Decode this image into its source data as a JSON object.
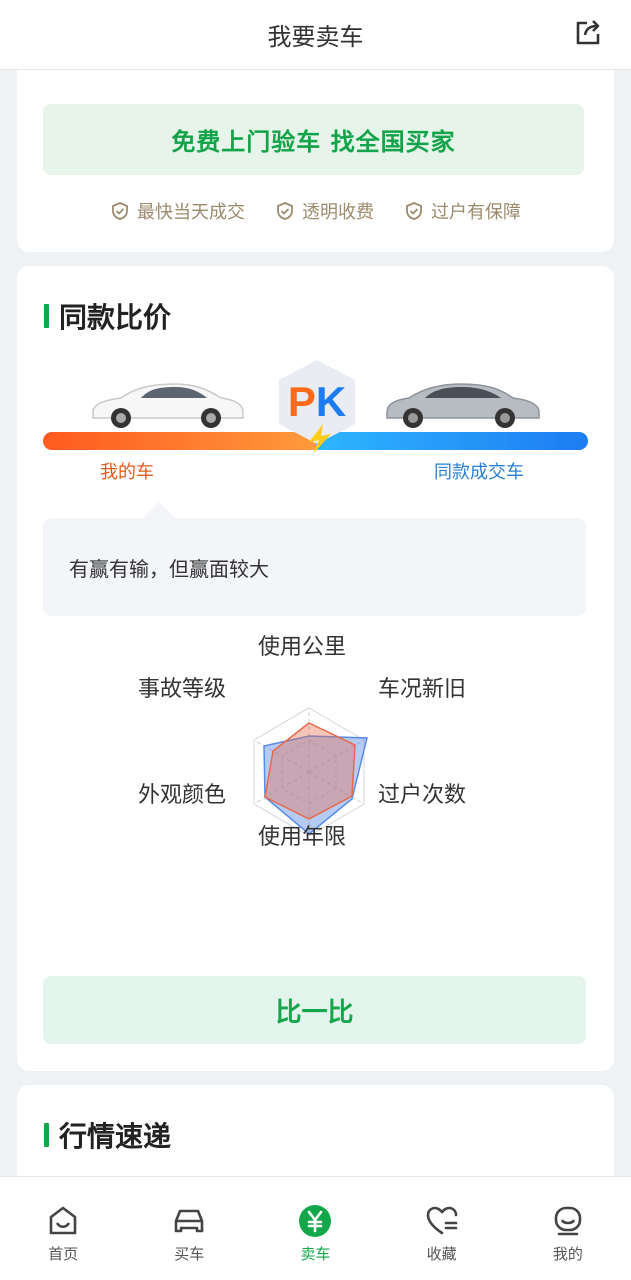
{
  "header": {
    "title": "我要卖车",
    "share_icon": "share-icon"
  },
  "hero": {
    "banner": "免费上门验车 找全国买家",
    "features": [
      {
        "icon": "shield-check-icon",
        "label": "最快当天成交"
      },
      {
        "icon": "shield-check-icon",
        "label": "透明收费"
      },
      {
        "icon": "shield-check-icon",
        "label": "过户有保障"
      }
    ]
  },
  "compare": {
    "title": "同款比价",
    "pk_text": "PK",
    "my_car_label": "我的车",
    "peer_car_label": "同款成交车",
    "verdict": "有赢有输，但赢面较大",
    "radar_axes": [
      "使用公里",
      "车况新旧",
      "过户次数",
      "使用年限",
      "外观颜色",
      "事故等级"
    ],
    "button": "比一比",
    "colors": {
      "mine": "#e8694a",
      "peer": "#5a8be6"
    }
  },
  "market": {
    "title": "行情速递"
  },
  "tabbar": {
    "items": [
      {
        "label": "首页",
        "icon": "home-icon"
      },
      {
        "label": "买车",
        "icon": "car-icon"
      },
      {
        "label": "卖车",
        "icon": "yen-icon",
        "active": true
      },
      {
        "label": "收藏",
        "icon": "heart-icon"
      },
      {
        "label": "我的",
        "icon": "profile-icon"
      }
    ]
  }
}
